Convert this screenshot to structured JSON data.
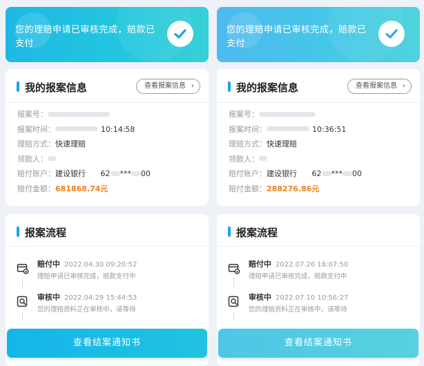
{
  "panels": [
    {
      "banner": {
        "text": "您的理赔申请已审核完成，赔款已支付"
      },
      "info": {
        "title": "我的报案信息",
        "view_button": "查看报案信息",
        "rows": [
          {
            "key": "报案号：",
            "value": "",
            "blur": 90
          },
          {
            "key": "报案时间：",
            "value": "10:14:58",
            "blur": 62
          },
          {
            "key": "理赔方式：",
            "value": "快速理赔"
          },
          {
            "key": "领款人：",
            "value": "",
            "blur": 12
          },
          {
            "key": "赔付账户：",
            "value": "建设银行",
            "account_prefix": "62",
            "account_mask": "***",
            "account_suffix": "00"
          },
          {
            "key": "赔付金额：",
            "value": "681868.74元",
            "amount": true
          }
        ]
      },
      "flow": {
        "title": "报案流程",
        "steps": [
          {
            "label": "赔付中",
            "time": "2022.04.30 09:20:52",
            "desc": "理赔申请已审核完成，赔款支付中"
          },
          {
            "label": "审核中",
            "time": "2022.04.29 15:44:53",
            "desc": "您的理赔资料正在审核中，请等待"
          }
        ]
      },
      "bottom_button": "查看结案通知书"
    },
    {
      "banner": {
        "text": "您的理赔申请已审核完成，赔款已支付"
      },
      "info": {
        "title": "我的报案信息",
        "view_button": "查看报案信息",
        "rows": [
          {
            "key": "报案号：",
            "value": "",
            "blur": 82
          },
          {
            "key": "报案时间：",
            "value": "10:36:51",
            "blur": 62
          },
          {
            "key": "理赔方式：",
            "value": "快速理赔"
          },
          {
            "key": "领款人：",
            "value": "",
            "blur": 12
          },
          {
            "key": "赔付账户：",
            "value": "建设银行",
            "account_prefix": "62",
            "account_mask": "***",
            "account_suffix": "00"
          },
          {
            "key": "赔付金额：",
            "value": "288276.86元",
            "amount": true
          }
        ]
      },
      "flow": {
        "title": "报案流程",
        "steps": [
          {
            "label": "赔付中",
            "time": "2022.07.26 18:07:50",
            "desc": "理赔申请已审核完成，赔款支付中"
          },
          {
            "label": "审核中",
            "time": "2022.07.10 10:56:27",
            "desc": "您的理赔资料正在审核中，请等待"
          }
        ]
      },
      "bottom_button": "查看结案通知书"
    }
  ],
  "icons": {
    "check": "check-icon",
    "chevron": "chevron-right-icon",
    "payment": "payment-card-icon",
    "review": "search-review-icon"
  },
  "colors": {
    "accent": "#1aa4e5",
    "amount": "#ef7f1a",
    "banner_left": "#1fb8e6",
    "banner_right": "#4fb9ef"
  }
}
